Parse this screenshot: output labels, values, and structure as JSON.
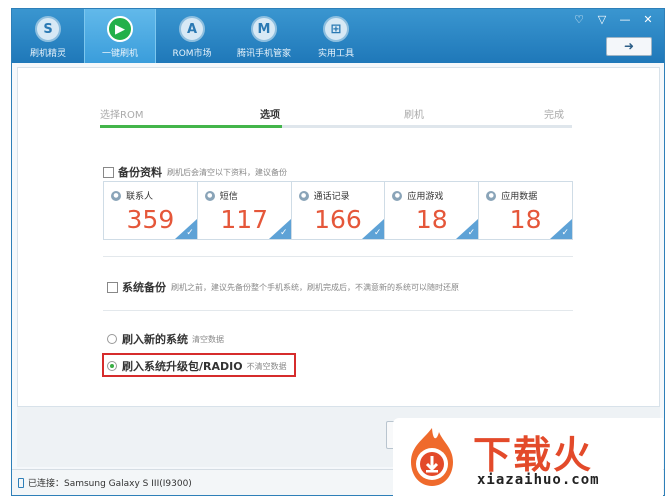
{
  "nav": {
    "items": [
      {
        "label": "刷机精灵",
        "icon": "S"
      },
      {
        "label": "一键刷机",
        "icon": "▶"
      },
      {
        "label": "ROM市场",
        "icon": "A"
      },
      {
        "label": "腾讯手机管家",
        "icon": "M"
      },
      {
        "label": "实用工具",
        "icon": "⊞"
      }
    ],
    "active_index": 1
  },
  "window_controls": {
    "feedback": "♡",
    "menu": "▽",
    "minimize": "—",
    "close": "✕"
  },
  "back_button": {
    "label": "➜"
  },
  "steps": {
    "labels": [
      "选择ROM",
      "选项",
      "刷机",
      "完成"
    ],
    "current_index": 1
  },
  "backup": {
    "title": "备份资料",
    "hint": "刷机后会清空以下资料，建议备份",
    "stats": [
      {
        "label": "联系人",
        "value": "359",
        "icon": "user-icon"
      },
      {
        "label": "短信",
        "value": "117",
        "icon": "message-icon"
      },
      {
        "label": "通话记录",
        "value": "166",
        "icon": "phone-icon"
      },
      {
        "label": "应用游戏",
        "value": "18",
        "icon": "app-icon"
      },
      {
        "label": "应用数据",
        "value": "18",
        "icon": "pie-icon"
      }
    ]
  },
  "system_backup": {
    "title": "系统备份",
    "hint": "刷机之前，建议先备份整个手机系统，刷机完成后，不满意新的系统可以随时还原"
  },
  "options": [
    {
      "label": "刷入新的系统",
      "hint": "清空数据",
      "selected": false
    },
    {
      "label": "刷入系统升级包/RADIO",
      "hint": "不清空数据",
      "selected": true
    }
  ],
  "status": {
    "connection": "已连接：Samsung Galaxy S III(I9300)"
  },
  "watermark": {
    "title": "下载火",
    "url": "xiazaihuo.com"
  },
  "colors": {
    "accent": "#1f78b9",
    "active_green": "#43b54a",
    "stat_value": "#e5573a",
    "highlight": "#d62c2c",
    "watermark": "#e34a2a"
  }
}
